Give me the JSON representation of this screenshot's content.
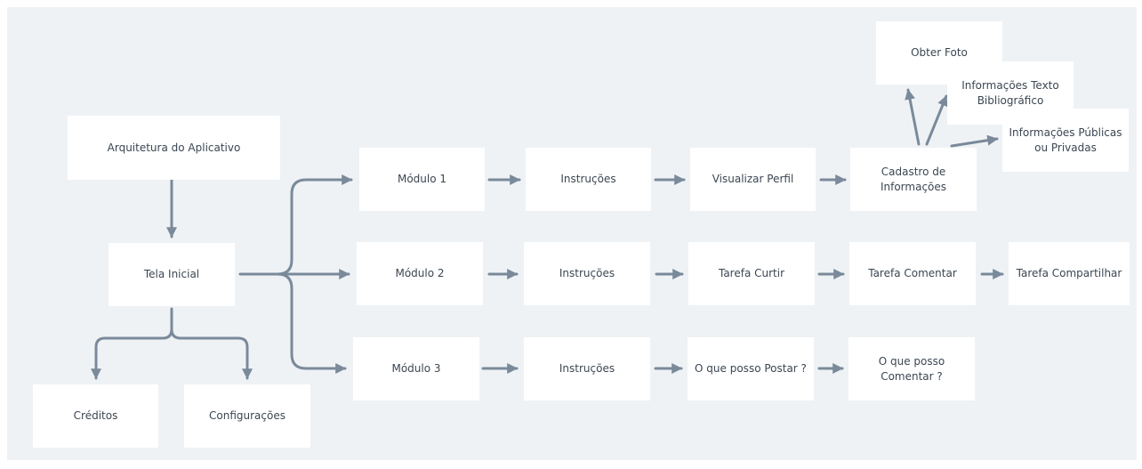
{
  "nodes": {
    "arquitetura": "Arquitetura do Aplicativo",
    "tela_inicial": "Tela Inicial",
    "creditos": "Créditos",
    "configuracoes": "Configurações",
    "modulo1": "Módulo 1",
    "modulo2": "Módulo 2",
    "modulo3": "Módulo 3",
    "instrucoes1": "Instruções",
    "instrucoes2": "Instruções",
    "instrucoes3": "Instruções",
    "visualizar_perfil": "Visualizar Perfil",
    "cadastro": "Cadastro de\nInformações",
    "obter_foto": "Obter Foto",
    "info_texto": "Informações Texto\nBibliográfico",
    "info_publicas": "Informações Públicas\nou Privadas",
    "tarefa_curtir": "Tarefa Curtir",
    "tarefa_comentar": "Tarefa Comentar",
    "tarefa_compartilhar": "Tarefa Compartilhar",
    "o_que_postar": "O que posso Postar ?",
    "o_que_comentar": "O que posso\nComentar ?"
  },
  "colors": {
    "background": "#eff2f5",
    "node_fill": "#ffffff",
    "node_text": "#3b4652",
    "connector": "#7a8a9a"
  }
}
